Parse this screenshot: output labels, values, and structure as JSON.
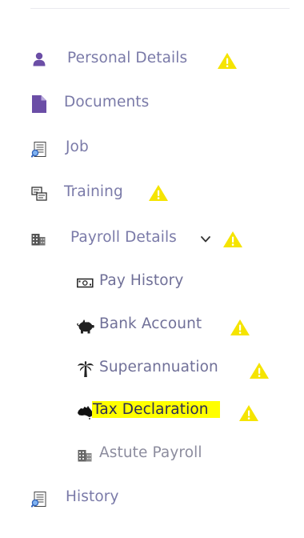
{
  "nav": {
    "items": [
      {
        "label": "Personal Details",
        "icon": "user-icon",
        "warning": true
      },
      {
        "label": "Documents",
        "icon": "document-icon",
        "warning": false
      },
      {
        "label": "Job",
        "icon": "job-icon",
        "warning": false
      },
      {
        "label": "Training",
        "icon": "training-icon",
        "warning": true
      },
      {
        "label": "Payroll Details",
        "icon": "payroll-icon",
        "warning": true,
        "expanded": true,
        "children": [
          {
            "label": "Pay History",
            "icon": "cash-icon",
            "warning": false
          },
          {
            "label": "Bank Account",
            "icon": "piggy-bank-icon",
            "warning": true
          },
          {
            "label": "Superannuation",
            "icon": "palm-tree-icon",
            "warning": true
          },
          {
            "label": "Tax Declaration",
            "icon": "australia-map-icon",
            "warning": true,
            "active": true
          },
          {
            "label": "Astute Payroll",
            "icon": "building-icon",
            "warning": false
          }
        ]
      },
      {
        "label": "History",
        "icon": "history-icon",
        "warning": false
      }
    ]
  },
  "colors": {
    "label": "#7a7aa8",
    "icon_purple": "#6b4ea6",
    "warning": "#f5e400",
    "highlight": "#ffff00"
  }
}
